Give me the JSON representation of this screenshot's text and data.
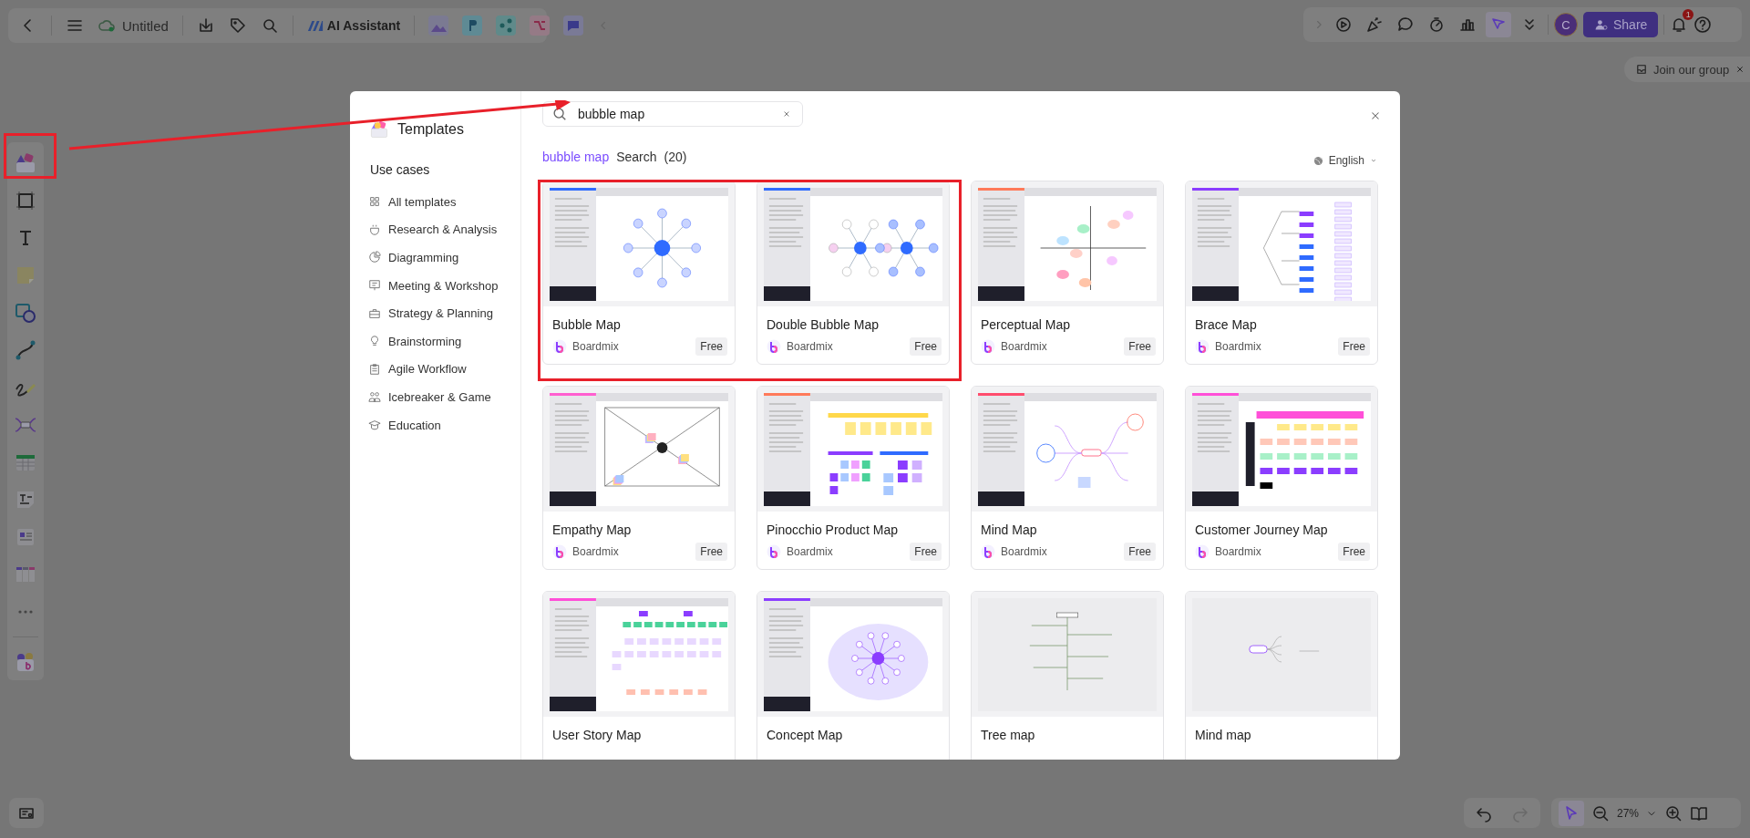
{
  "top_bar": {
    "title": "Untitled",
    "ai_label": "AI Assistant"
  },
  "top_right": {
    "tools": [
      {
        "selected": false
      },
      {
        "selected": false
      },
      {
        "selected": false
      },
      {
        "selected": false
      },
      {
        "selected": false
      },
      {
        "selected": true
      },
      {
        "selected": false
      }
    ],
    "avatar_letter": "C",
    "share_label": "Share",
    "notification_count": "1"
  },
  "join_group": {
    "label": "Join our group"
  },
  "templates_dialog": {
    "title": "Templates",
    "use_cases_heading": "Use cases",
    "categories": [
      {
        "label": "All templates"
      },
      {
        "label": "Research & Analysis"
      },
      {
        "label": "Diagramming"
      },
      {
        "label": "Meeting & Workshop"
      },
      {
        "label": "Strategy & Planning"
      },
      {
        "label": "Brainstorming"
      },
      {
        "label": "Agile Workflow"
      },
      {
        "label": "Icebreaker & Game"
      },
      {
        "label": "Education"
      }
    ],
    "search": {
      "value": "bubble map"
    },
    "results": {
      "query": "bubble map",
      "label": "Search",
      "count": "(20)"
    },
    "language": "English",
    "cards": [
      {
        "title": "Bubble Map",
        "author": "Boardmix",
        "price": "Free",
        "kind": "bubble"
      },
      {
        "title": "Double Bubble Map",
        "author": "Boardmix",
        "price": "Free",
        "kind": "double-bubble"
      },
      {
        "title": "Perceptual Map",
        "author": "Boardmix",
        "price": "Free",
        "kind": "quadrant"
      },
      {
        "title": "Brace Map",
        "author": "Boardmix",
        "price": "Free",
        "kind": "brace"
      },
      {
        "title": "Empathy Map",
        "author": "Boardmix",
        "price": "Free",
        "kind": "empathy"
      },
      {
        "title": "Pinocchio Product Map",
        "author": "Boardmix",
        "price": "Free",
        "kind": "board"
      },
      {
        "title": "Mind Map",
        "author": "Boardmix",
        "price": "Free",
        "kind": "mind"
      },
      {
        "title": "Customer Journey Map",
        "author": "Boardmix",
        "price": "Free",
        "kind": "journey"
      },
      {
        "title": "User Story Map",
        "kind": "story"
      },
      {
        "title": "Concept Map",
        "kind": "concept"
      },
      {
        "title": "Tree map",
        "kind": "tree"
      },
      {
        "title": "Mind map",
        "kind": "mind-simple"
      }
    ]
  },
  "bottom_bar": {
    "select_tool": {
      "selected": true
    },
    "zoom_value": "27%"
  }
}
